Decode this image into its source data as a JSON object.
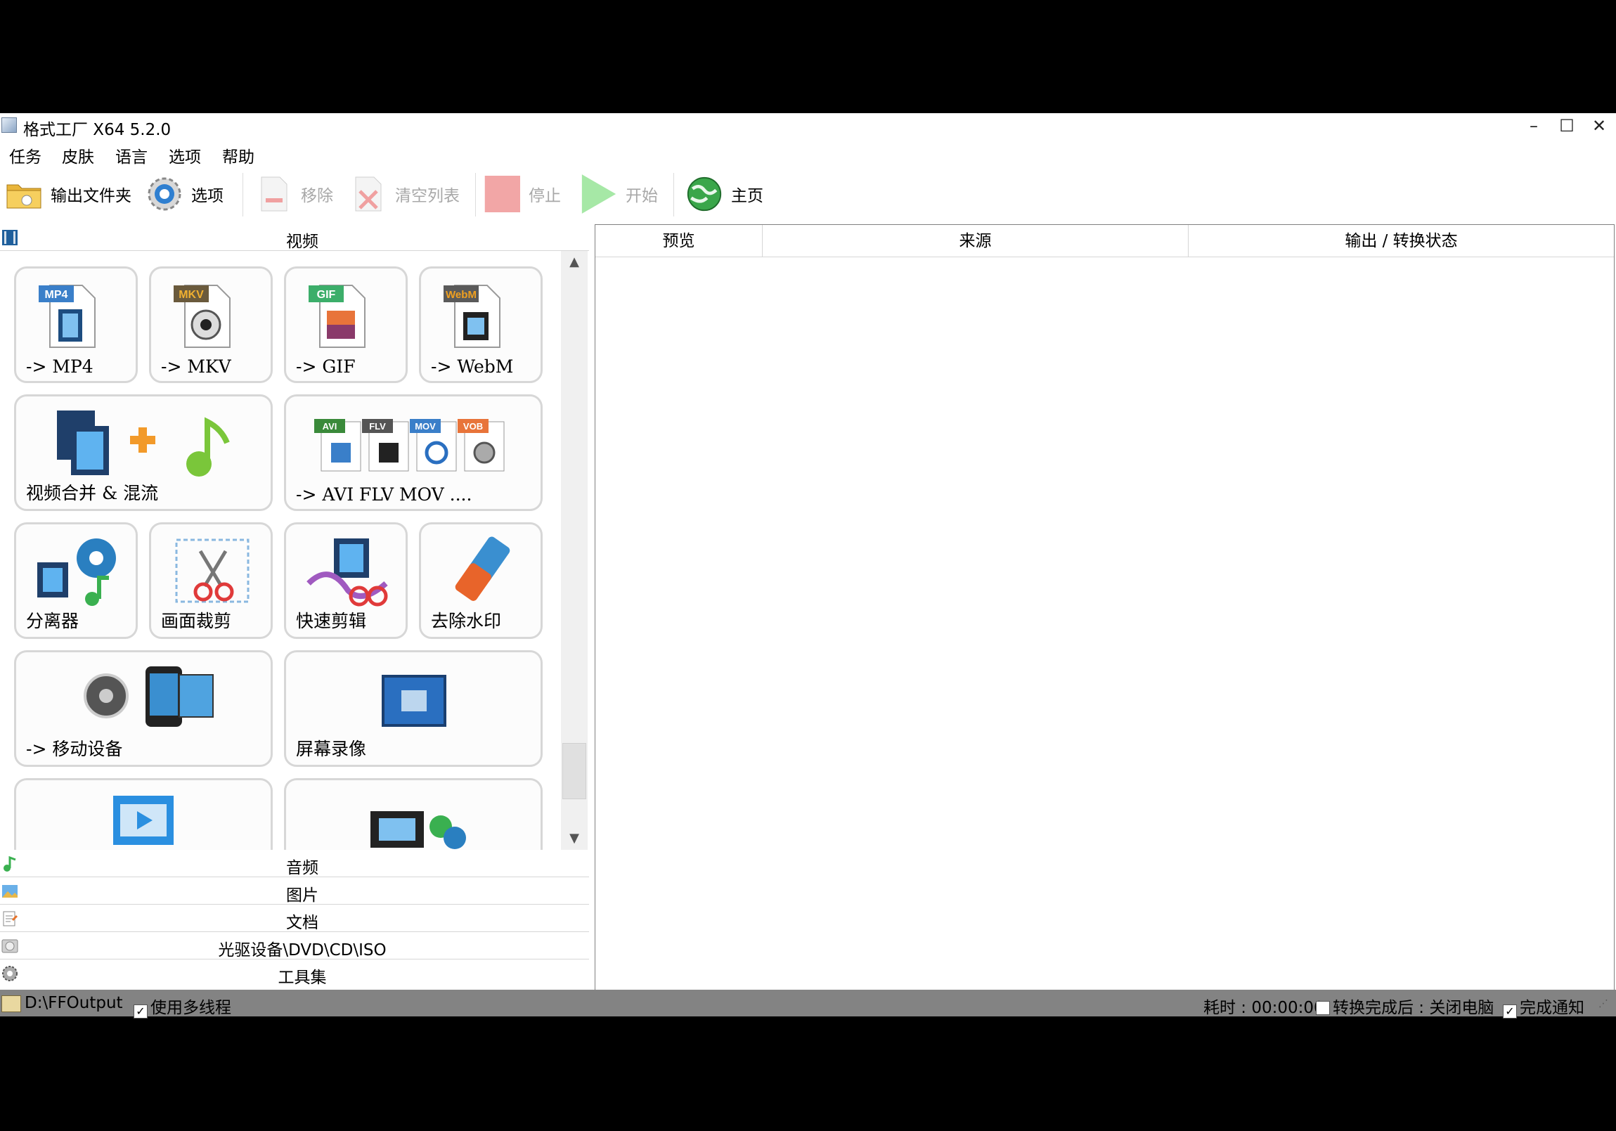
{
  "window": {
    "title": "格式工厂 X64 5.2.0",
    "controls": {
      "minimize": "–",
      "maximize": "☐",
      "close": "✕"
    }
  },
  "menu": [
    "任务",
    "皮肤",
    "语言",
    "选项",
    "帮助"
  ],
  "toolbar": {
    "output_folder": "输出文件夹",
    "options": "选项",
    "remove": "移除",
    "clear_list": "清空列表",
    "stop": "停止",
    "start": "开始",
    "home": "主页"
  },
  "left": {
    "video_header": "视频",
    "tiles": [
      {
        "label": "-> MP4",
        "badge": "MP4",
        "badge_color": "#3a7fc9"
      },
      {
        "label": "-> MKV",
        "badge": "MKV",
        "badge_color": "#6a5a3c"
      },
      {
        "label": "-> GIF",
        "badge": "GIF",
        "badge_color": "#3cae6a"
      },
      {
        "label": "-> WebM",
        "badge": "WebM",
        "badge_color": "#5a5a5a"
      },
      {
        "label": "视频合并 & 混流"
      },
      {
        "label": "-> AVI FLV MOV ....",
        "badges": [
          "AVI",
          "FLV",
          "MOV",
          "VOB"
        ]
      },
      {
        "label": "分离器"
      },
      {
        "label": "画面裁剪"
      },
      {
        "label": "快速剪辑"
      },
      {
        "label": "去除水印"
      },
      {
        "label": "-> 移动设备"
      },
      {
        "label": "屏幕录像"
      }
    ],
    "categories": [
      "音频",
      "图片",
      "文档",
      "光驱设备\\DVD\\CD\\ISO",
      "工具集"
    ]
  },
  "table": {
    "columns": [
      "预览",
      "来源",
      "输出 / 转换状态"
    ]
  },
  "status": {
    "output_path": "D:\\FFOutput",
    "multithread_label": "使用多线程",
    "multithread_checked": true,
    "elapsed": "耗时 : 00:00:00",
    "shutdown_label": "转换完成后 : 关闭电脑",
    "shutdown_checked": false,
    "notify_label": "完成通知",
    "notify_checked": true
  }
}
